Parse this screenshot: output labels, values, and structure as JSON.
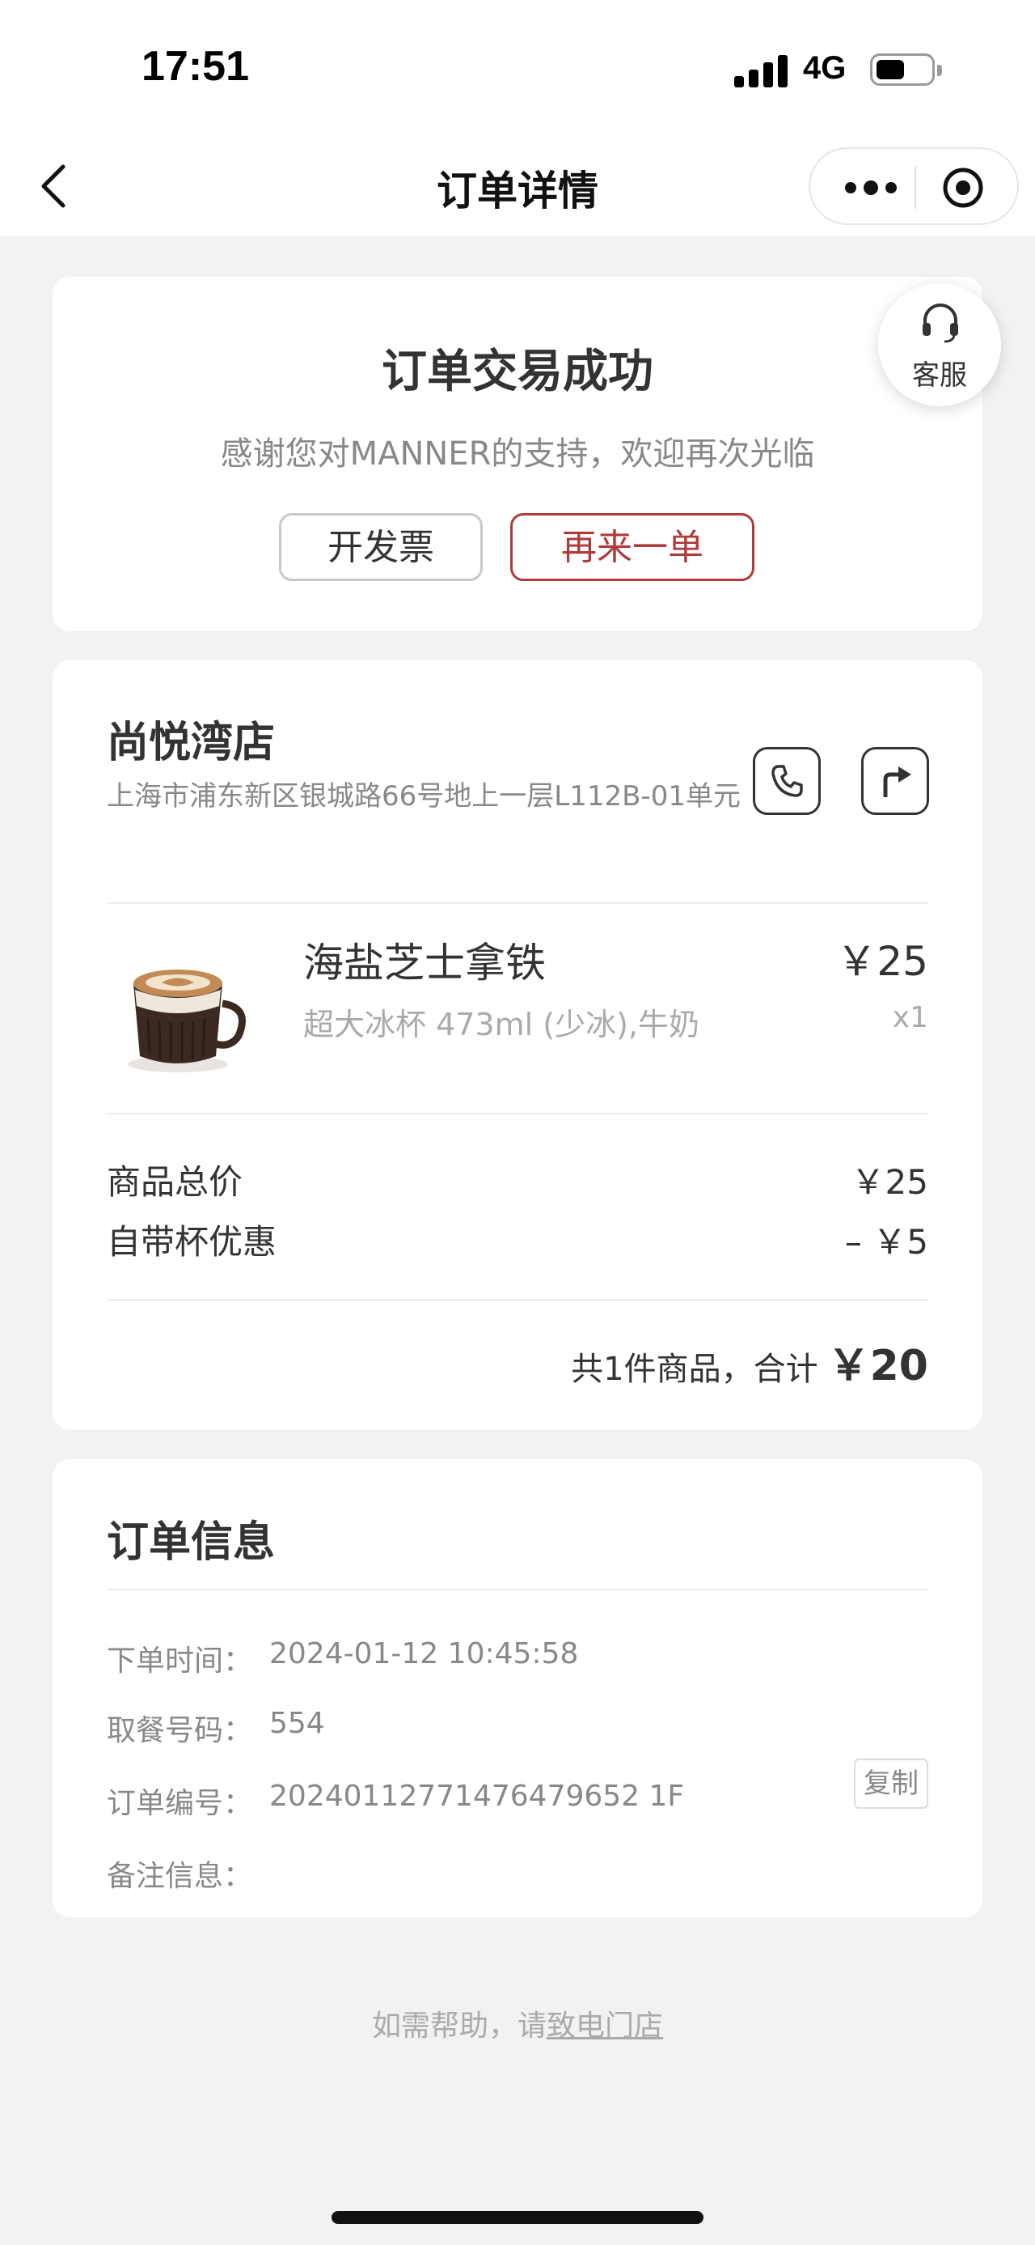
{
  "status_bar": {
    "time": "17:51",
    "network": "4G"
  },
  "nav": {
    "title": "订单详情"
  },
  "success": {
    "title": "订单交易成功",
    "subtitle": "感谢您对MANNER的支持，欢迎再次光临",
    "invoice_label": "开发票",
    "reorder_label": "再来一单"
  },
  "service": {
    "label": "客服"
  },
  "store": {
    "name": "尚悦湾店",
    "address": "上海市浦东新区银城路66号地上一层L112B-01单元"
  },
  "product": {
    "name": "海盐芝士拿铁",
    "spec": "超大冰杯 473ml (少冰),牛奶",
    "price": "￥25",
    "qty": "x1"
  },
  "fees": {
    "subtotal_label": "商品总价",
    "subtotal_value": "￥25",
    "cup_discount_label": "自带杯优惠",
    "cup_discount_value": "– ￥5"
  },
  "total": {
    "prefix": "共1件商品，合计",
    "amount": "￥20"
  },
  "order_info": {
    "title": "订单信息",
    "time_label": "下单时间：",
    "time_value": "2024-01-12 10:45:58",
    "pickup_label": "取餐号码：",
    "pickup_value": "554",
    "order_no_label": "订单编号：",
    "order_no_value": "20240112771476479652 1F",
    "copy_label": "复制",
    "remark_label": "备注信息："
  },
  "help": {
    "prefix": "如需帮助，请",
    "link": "致电门店"
  },
  "colors": {
    "accent": "#b03a3a",
    "background": "#f2f2f2"
  }
}
